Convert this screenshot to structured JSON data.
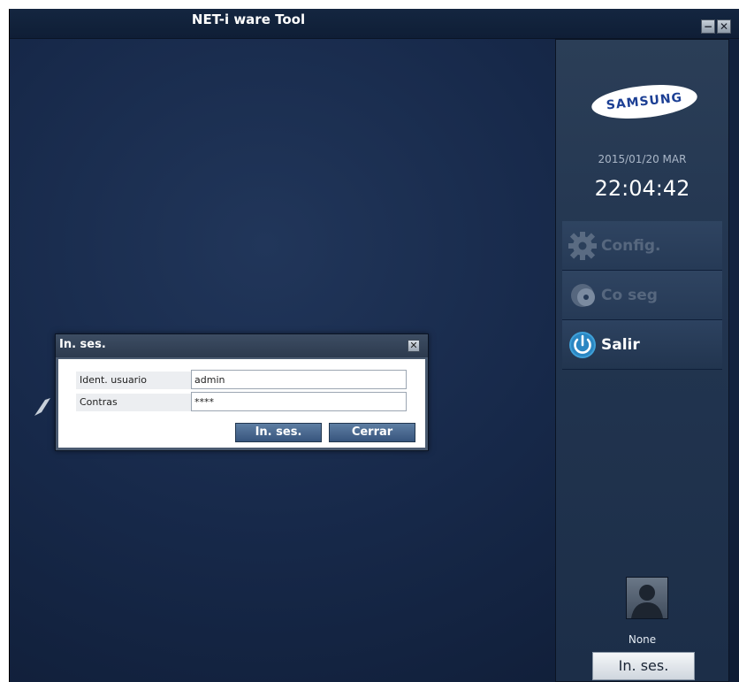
{
  "window": {
    "title": "NET-i ware Tool",
    "minimize_label": "−",
    "close_label": "✕"
  },
  "brand": {
    "logo_text": "SAMSUNG",
    "logo_color": "#1c3f94"
  },
  "clock": {
    "date": "2015/01/20 MAR",
    "time": "22:04:42"
  },
  "menu": {
    "items": [
      {
        "label": "Config.",
        "icon": "gear-icon",
        "state": "disabled"
      },
      {
        "label": "Co seg",
        "icon": "disc-icon",
        "state": "disabled"
      },
      {
        "label": "Salir",
        "icon": "power-icon",
        "state": "active"
      }
    ]
  },
  "user": {
    "name": "None",
    "login_button": "In. ses."
  },
  "dialog": {
    "title": "In. ses.",
    "close_label": "✕",
    "fields": [
      {
        "label": "Ident. usuario",
        "value": "admin"
      },
      {
        "label": "Contras",
        "value": "****"
      }
    ],
    "ok_button": "In. ses.",
    "cancel_button": "Cerrar"
  },
  "colors": {
    "background": "#17294a",
    "panel": "#223550",
    "accent_blue": "#37557d"
  }
}
